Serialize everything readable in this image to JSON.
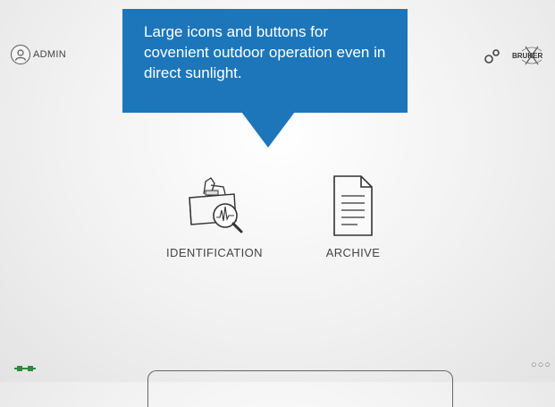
{
  "header": {
    "user_label": "ADMIN",
    "icons": [
      "user-avatar-icon",
      "settings-gear-icon",
      "bruker-logo"
    ]
  },
  "tooltip": {
    "text": "Large icons and buttons for covenient outdoor operation even in direct sunlight."
  },
  "tiles": [
    {
      "label": "IDENTIFICATION",
      "icon": "identification-icon"
    },
    {
      "label": "ARCHIVE",
      "icon": "archive-document-icon"
    }
  ],
  "footer": {
    "icons": [
      "connection-plug-icon",
      "page-dots-icon"
    ]
  },
  "colors": {
    "tooltip_bg": "#1c76b9",
    "accent_green": "#2e8b3d"
  }
}
